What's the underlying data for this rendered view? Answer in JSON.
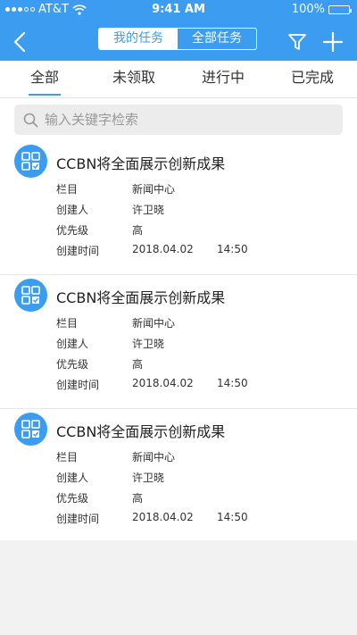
{
  "status_bar": {
    "carrier": "AT&T",
    "time": "9:41 AM",
    "battery": "100%",
    "battery_level": 1.0
  },
  "header": {
    "segments": [
      {
        "label": "我的任务",
        "active": true
      },
      {
        "label": "全部任务",
        "active": false
      }
    ],
    "back_icon": "chevron-left-icon",
    "filter_icon": "filter-icon",
    "add_icon": "plus-icon"
  },
  "tabs": [
    {
      "label": "全部",
      "active": true
    },
    {
      "label": "未领取",
      "active": false
    },
    {
      "label": "进行中",
      "active": false
    },
    {
      "label": "已完成",
      "active": false
    }
  ],
  "search": {
    "placeholder": "输入关键字检索",
    "value": ""
  },
  "labels": {
    "column": "栏目",
    "creator": "创建人",
    "priority": "优先级",
    "created_time": "创建时间"
  },
  "tasks": [
    {
      "title": "CCBN将全面展示创新成果",
      "column": "新闻中心",
      "creator": "许卫晓",
      "priority": "高",
      "date": "2018.04.02",
      "time": "14:50"
    },
    {
      "title": "CCBN将全面展示创新成果",
      "column": "新闻中心",
      "creator": "许卫晓",
      "priority": "高",
      "date": "2018.04.02",
      "time": "14:50"
    },
    {
      "title": "CCBN将全面展示创新成果",
      "column": "新闻中心",
      "creator": "许卫晓",
      "priority": "高",
      "date": "2018.04.02",
      "time": "14:50"
    }
  ],
  "colors": {
    "primary": "#3b9cf0",
    "page_bg": "#f2f2f2",
    "search_bg": "#ececec",
    "text": "#333333"
  }
}
